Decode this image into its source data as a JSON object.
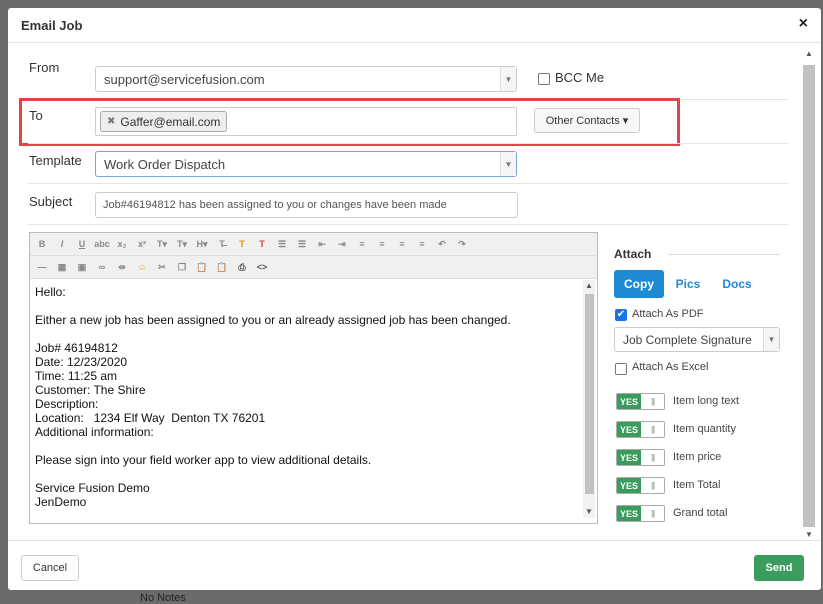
{
  "modal": {
    "title": "Email Job",
    "close": "×"
  },
  "form": {
    "from_label": "From",
    "from_value": "support@servicefusion.com",
    "bcc_label": "BCC Me",
    "to_label": "To",
    "to_tags": [
      "Gaffer@email.com"
    ],
    "other_contacts_label": "Other Contacts ▾",
    "template_label": "Template",
    "template_value": "Work Order Dispatch",
    "subject_label": "Subject",
    "subject_value": "Job#46194812 has been assigned to you or changes have been made"
  },
  "editor": {
    "content": "Hello:\n\nEither a new job has been assigned to you or an already assigned job has been changed.\n\nJob# 46194812\nDate: 12/23/2020\nTime: 11:25 am\nCustomer: The Shire\nDescription:\nLocation:   1234 Elf Way  Denton TX 76201\nAdditional information:\n\nPlease sign into your field worker app to view additional details.\n\nService Fusion Demo\nJenDemo"
  },
  "attach": {
    "title": "Attach",
    "tabs": [
      "Copy",
      "Pics",
      "Docs"
    ],
    "active_tab": "Copy",
    "attach_pdf_label": "Attach As PDF",
    "attach_pdf_checked": true,
    "pdf_template": "Job Complete Signature",
    "attach_excel_label": "Attach As Excel",
    "attach_excel_checked": false,
    "toggle_yes": "YES",
    "toggle_grip": "|||",
    "toggles": [
      {
        "label": "Item long text",
        "on": true
      },
      {
        "label": "Item quantity",
        "on": true
      },
      {
        "label": "Item price",
        "on": true
      },
      {
        "label": "Item Total",
        "on": true
      },
      {
        "label": "Grand total",
        "on": true
      }
    ]
  },
  "footer": {
    "cancel_label": "Cancel",
    "send_label": "Send"
  },
  "background": {
    "peek_text": "No Notes"
  }
}
